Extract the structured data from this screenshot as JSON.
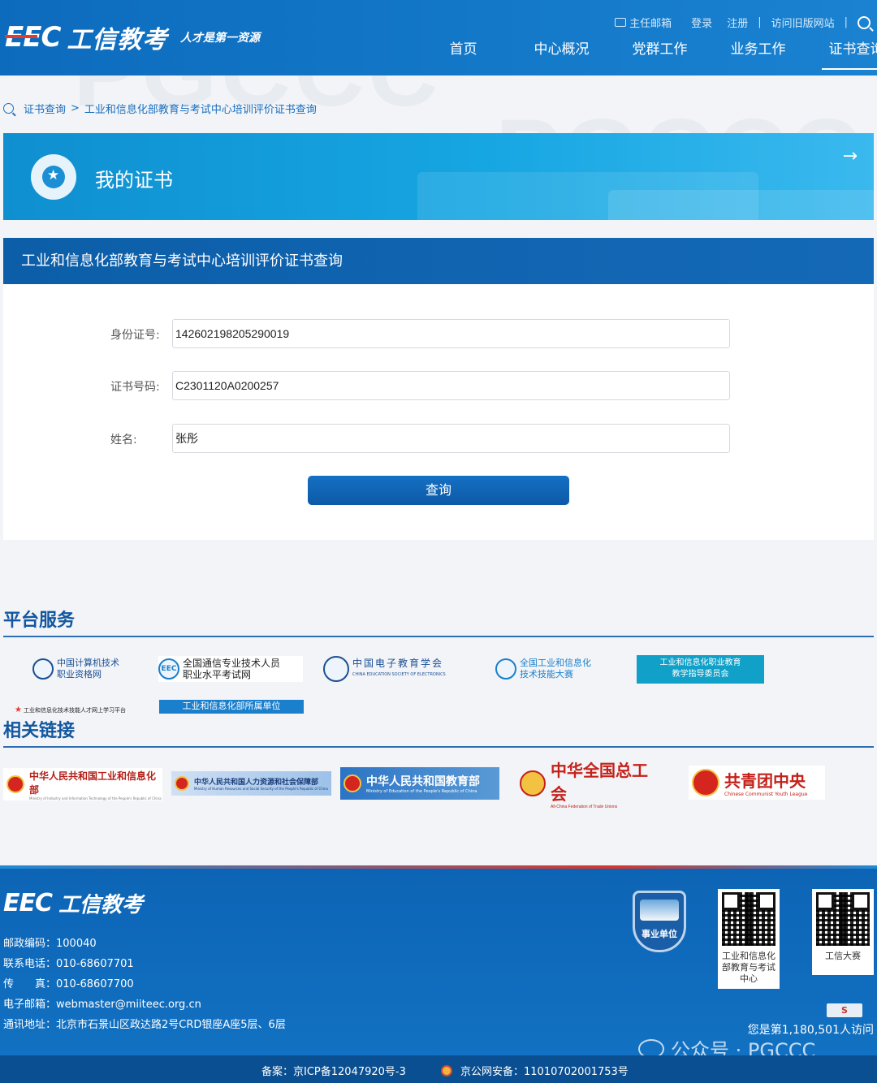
{
  "header": {
    "logo_mark": "EEC",
    "logo_text": "工信教考",
    "slogan": "人才是第一资源",
    "top_links": {
      "mail": "主任邮箱",
      "login": "登录",
      "register": "注册",
      "old_site": "访问旧版网站"
    },
    "nav": [
      "首页",
      "中心概况",
      "党群工作",
      "业务工作",
      "证书查询"
    ],
    "active_nav": "证书查询"
  },
  "breadcrumb": {
    "root": "证书查询",
    "separator": ">",
    "current": "工业和信息化部教育与考试中心培训评价证书查询"
  },
  "banner": {
    "title": "我的证书",
    "arrow": "→"
  },
  "form": {
    "heading": "工业和信息化部教育与考试中心培训评价证书查询",
    "id_label": "身份证号:",
    "id_value": "142602198205290019",
    "cert_label": "证书号码:",
    "cert_value": "C2301120A0200257",
    "name_label": "姓名:",
    "name_value": "张彤",
    "submit_label": "查询"
  },
  "services": {
    "title": "平台服务",
    "items": [
      {
        "line1": "中国计算机技术",
        "line2": "职业资格网"
      },
      {
        "line1": "全国通信专业技术人员",
        "line2": "职业水平考试网"
      },
      {
        "line1": "中国电子教育学会",
        "line2": "CHINA EDUCATION SOCIETY OF ELECTRONICS"
      },
      {
        "line1": "全国工业和信息化",
        "line2": "技术技能大赛"
      },
      {
        "line1": "工业和信息化职业教育",
        "line2": "教学指导委员会"
      },
      {
        "line1": "工业和信息化技术技能人才网上学习平台"
      },
      {
        "line1": "工业和信息化部所属单位"
      }
    ]
  },
  "links": {
    "title": "相关链接",
    "items": [
      {
        "name": "中华人民共和国工业和信息化部",
        "sub": "Ministry of Industry and Information Technology of the People's Republic of China"
      },
      {
        "name": "中华人民共和国人力资源和社会保障部",
        "sub": "Ministry of Human Resources and Social Security of the People's Republic of China"
      },
      {
        "name": "中华人民共和国教育部",
        "sub": "Ministry of Education of the People's Republic of China"
      },
      {
        "name": "中华全国总工会",
        "sub": "All-China Federation of Trade Unions"
      },
      {
        "name": "共青团中央",
        "sub": "Chinese Communist Youth League"
      }
    ]
  },
  "footer": {
    "logo_mark": "EEC",
    "logo_text": "工信教考",
    "postcode": "邮政编码：100040",
    "phone": "联系电话：010-68607701",
    "fax": "传　　真：010-68607700",
    "email": "电子邮箱：webmaster@miiteec.org.cn",
    "address": "通讯地址：北京市石景山区政达路2号CRD银座A座5层、6层",
    "badge": "事业单位",
    "qr1": "工业和信息化部教育与考试中心",
    "qr2": "工信大赛",
    "counter_icon": "S",
    "visits": "您是第1,180,501人访问",
    "icp": "备案：京ICP备12047920号-3",
    "police": "京公网安备：11010702001753号",
    "wechat": "公众号 · PGCCC"
  },
  "colors": {
    "primary": "#0d6bbd",
    "accent_red": "#e63a2f",
    "banner": "#16a6e2"
  }
}
